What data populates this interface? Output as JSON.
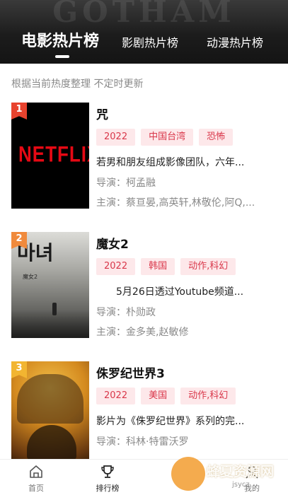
{
  "header": {
    "watermark_text": "GOTHAM",
    "tabs": [
      {
        "label": "电影热片榜",
        "active": true
      },
      {
        "label": "影剧热片榜",
        "active": false
      },
      {
        "label": "动漫热片榜",
        "active": false
      }
    ]
  },
  "subtitle": "根据当前热度整理 不定时更新",
  "items": [
    {
      "rank": "1",
      "rank_color": "#e8432e",
      "title": "咒",
      "tags": [
        "2022",
        "中国台湾",
        "恐怖"
      ],
      "description": "若男和朋友组成影像团队，六年...",
      "director": "导演：柯孟融",
      "cast": "主演：蔡亘晏,高英轩,林敬伦,阿Q,...",
      "poster_text": "NETFLIX"
    },
    {
      "rank": "2",
      "rank_color": "#f08a3c",
      "title": "魔女2",
      "tags": [
        "2022",
        "韩国",
        "动作,科幻"
      ],
      "description": "　　5月26日透过Youtube频道...",
      "director": "导演：朴勋政",
      "cast": "主演：金多美,赵敏修",
      "poster_text": "마녀",
      "poster_subtext": "魔女2"
    },
    {
      "rank": "3",
      "rank_color": "#f2b531",
      "title": "侏罗纪世界3",
      "tags": [
        "2022",
        "美国",
        "动作,科幻"
      ],
      "description": "影片为《侏罗纪世界》系列的完...",
      "director": "导演：科林·特雷沃罗",
      "cast": ""
    }
  ],
  "bottom_nav": [
    {
      "label": "首页",
      "icon": "home-icon",
      "active": false
    },
    {
      "label": "排行榜",
      "icon": "trophy-icon",
      "active": true
    },
    {
      "label": "",
      "icon": "",
      "active": false
    },
    {
      "label": "我的",
      "icon": "user-icon",
      "active": false
    }
  ],
  "watermark": {
    "text": "蜂夏资源网",
    "url": "jsycz"
  },
  "colors": {
    "tag_text": "#d9374a",
    "tag_bg": "#fde8ea",
    "header_bg": "#1c1c1c"
  }
}
